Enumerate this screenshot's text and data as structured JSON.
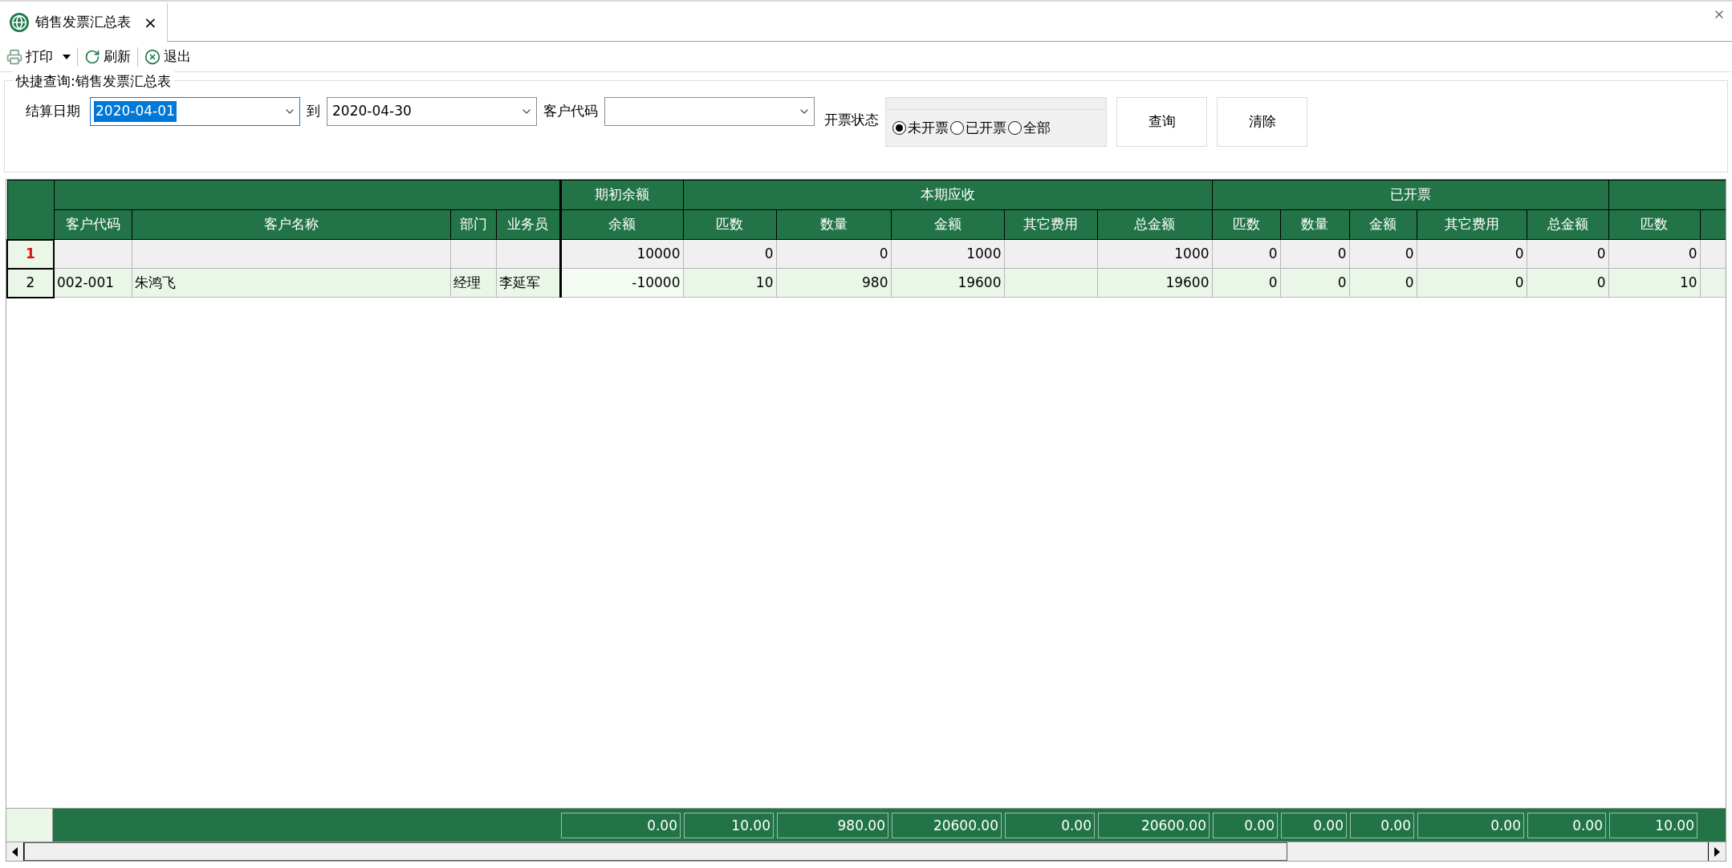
{
  "tab": {
    "title": "销售发票汇总表",
    "close": "×"
  },
  "toolbar": [
    {
      "label": "打印",
      "kind": "print",
      "dropdown": true
    },
    {
      "label": "刷新",
      "kind": "refresh",
      "dropdown": false
    },
    {
      "label": "退出",
      "kind": "exit",
      "dropdown": false
    }
  ],
  "query": {
    "title": "快捷查询:销售发票汇总表",
    "fields": [
      {
        "label": "结算日期",
        "value": "2020-04-01",
        "focused": true
      },
      {
        "label": "到",
        "value": "2020-04-30",
        "focused": false
      },
      {
        "label": "客户代码",
        "focused": false
      }
    ],
    "status_label": "开票状态",
    "status_options": [
      {
        "label": "未开票",
        "selected": true
      },
      {
        "label": "已开票",
        "selected": false
      },
      {
        "label": "全部",
        "selected": false
      }
    ],
    "buttons": [
      "查询",
      "清除"
    ]
  },
  "grid": {
    "groups": [
      {
        "label": "期初余额"
      },
      {
        "label": "本期应收"
      },
      {
        "label": "已开票"
      }
    ],
    "columns": [
      {
        "label": "客户代码",
        "kind": "text"
      },
      {
        "label": "客户名称",
        "kind": "text"
      },
      {
        "label": "部门",
        "kind": "text"
      },
      {
        "label": "业务员",
        "kind": "text"
      },
      {
        "label": "余额",
        "kind": "number"
      },
      {
        "label": "匹数",
        "kind": "number"
      },
      {
        "label": "数量",
        "kind": "number"
      },
      {
        "label": "金额",
        "kind": "number"
      },
      {
        "label": "其它费用",
        "kind": "number"
      },
      {
        "label": "总金额",
        "kind": "number"
      },
      {
        "label": "匹数",
        "kind": "number"
      },
      {
        "label": "数量",
        "kind": "number"
      },
      {
        "label": "金额",
        "kind": "number"
      },
      {
        "label": "其它费用",
        "kind": "number"
      },
      {
        "label": "总金额",
        "kind": "number"
      },
      {
        "label": "匹数",
        "kind": "number"
      }
    ],
    "rows": [
      {
        "number": "1",
        "selected": true,
        "cells": [
          null,
          null,
          null,
          null,
          "10000",
          "0",
          "0",
          "1000",
          null,
          "1000",
          "0",
          "0",
          "0",
          "0",
          "0",
          "0"
        ]
      },
      {
        "number": "2",
        "selected": false,
        "cells": [
          "002-001",
          "朱鸿飞",
          "经理",
          "李延军",
          "-10000",
          "10",
          "980",
          "19600",
          null,
          "19600",
          "0",
          "0",
          "0",
          "0",
          "0",
          "10"
        ]
      }
    ],
    "totals": [
      "0.00",
      "10.00",
      "980.00",
      "20600.00",
      "0.00",
      "20600.00",
      "0.00",
      "0.00",
      "0.00",
      "0.00",
      "0.00",
      "10.00"
    ]
  }
}
